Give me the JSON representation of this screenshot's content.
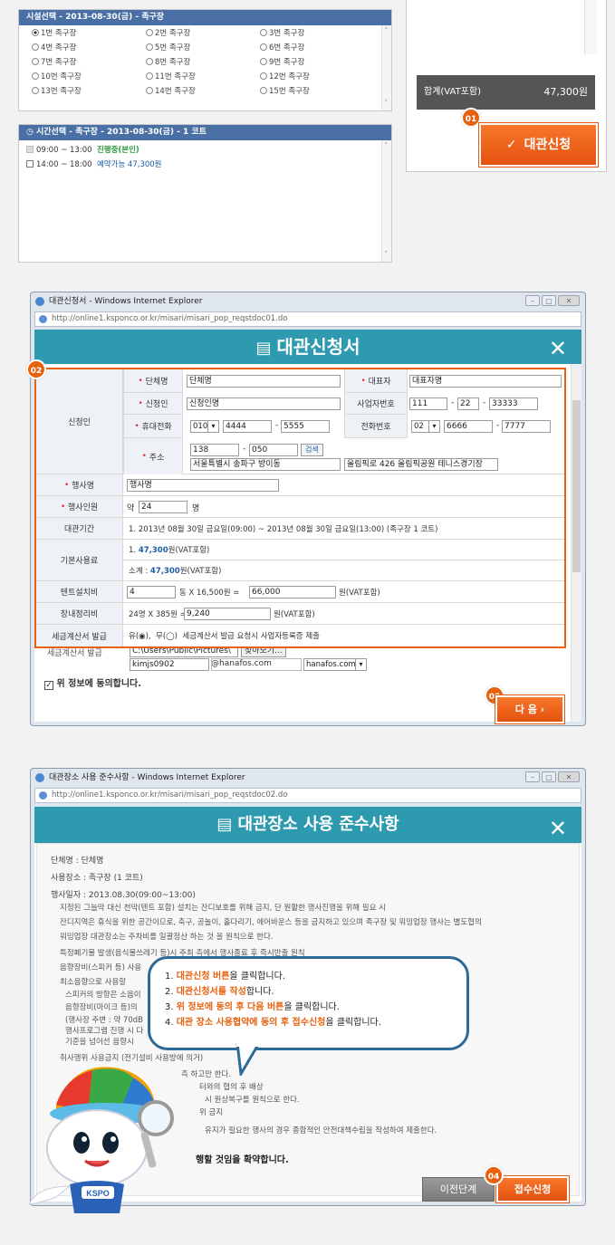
{
  "facility_panel": {
    "title": "시설선택 - 2013-08-30(금) - 족구장",
    "options": [
      "1번 족구장",
      "2번 족구장",
      "3번 족구장",
      "4번 족구장",
      "5번 족구장",
      "6번 족구장",
      "7번 족구장",
      "8번 족구장",
      "9번 족구장",
      "10번 족구장",
      "11번 족구장",
      "12번 족구장",
      "13번 족구장",
      "14번 족구장",
      "15번 족구장"
    ],
    "selected": "1번 족구장"
  },
  "time_panel": {
    "title": "시간선택 - 족구장 - 2013-08-30(금) - 1 코트",
    "slots": [
      {
        "time": "09:00 ~ 13:00",
        "status": "진행중(본인)"
      },
      {
        "time": "14:00 ~ 18:00",
        "status": "예약가능 47,300원"
      }
    ]
  },
  "summary": {
    "total_label": "합계(VAT포함)",
    "total_value": "47,300원",
    "apply_button": "대관신청",
    "check_glyph": "✓"
  },
  "badges": {
    "b1": "01",
    "b2": "02",
    "b3": "03",
    "b4": "04"
  },
  "window1": {
    "title": "대관신청서 - Windows Internet Explorer",
    "url": "http://online1.ksponco.or.kr/misari/misari_pop_reqstdoc01.do",
    "header": "대관신청서",
    "close_glyph": "✕"
  },
  "form": {
    "applicant_label": "신청인",
    "group_label": "단체명",
    "group_value": "단체명",
    "rep_label": "대표자",
    "rep_value": "대표자명",
    "applicant_name_label": "신청인",
    "applicant_name_value": "신청인명",
    "bizno_label": "사업자번호",
    "bizno": [
      "111",
      "22",
      "33333"
    ],
    "mobile_label": "휴대전화",
    "mobile": [
      "010",
      "4444",
      "5555"
    ],
    "phone_label": "전화번호",
    "phone": [
      "02",
      "6666",
      "7777"
    ],
    "address_label": "주소",
    "zip": [
      "138",
      "050"
    ],
    "search_button": "검색",
    "address1": "서울특별시 송파구 방이동",
    "address2": "올림픽로 426 올림픽공원 테니스경기장",
    "event_label": "행사명",
    "event_value": "행사명",
    "people_label": "행사인원",
    "people_prefix": "약",
    "people_value": "24",
    "people_unit": "명",
    "period_label": "대관기간",
    "period_value": "1. 2013년 08월  30일 금요일(09:00) ~ 2013년 08월  30일 금요일(13:00) (족구장 1 코트)",
    "fee_label": "기본사용료",
    "fee_line1_prefix": "1.",
    "fee_line1_value": "47,300",
    "fee_line1_suffix": "원(VAT포함)",
    "fee_line2_prefix": "소계 :",
    "fee_line2_value": "47,300",
    "fee_line2_suffix": "원(VAT포함)",
    "tent_label": "텐트설치비",
    "tent_qty": "4",
    "tent_calc": "동 X 16,500원 =",
    "tent_total": "66,000",
    "tent_suffix": "원(VAT포함)",
    "cleanup_label": "장내정리비",
    "cleanup_calc": "24명 X 385원 =",
    "cleanup_total": "9,240",
    "cleanup_suffix": "원(VAT포함)",
    "invoice_label": "세금계산서 발급",
    "invoice_yes": "유(",
    "invoice_yes_end": "),",
    "invoice_no": "무(",
    "invoice_no_end": ")",
    "invoice_note": "세금계산서 발급 요청시 사업자등록증 제출",
    "radio_on": "◉",
    "radio_off": "◯"
  },
  "form_behind": {
    "label": "세금계산서 발급",
    "file_path": "C:\\Users\\Public\\Pictures\\",
    "file_button": "찾아보기...",
    "email_user": "kimjs0902",
    "email_domain": "@hanafos.com",
    "email_select": "hanafos.com",
    "agree": "위 정보에 동의합니다.",
    "next_button": "다 음 ›"
  },
  "window2": {
    "title": "대관장소 사용 준수사항 - Windows Internet Explorer",
    "url": "http://online1.ksponco.or.kr/misari/misari_pop_reqstdoc02.do",
    "header": "대관장소 사용 준수사항",
    "close_glyph": "✕",
    "lines": [
      "단체명 : 단체명",
      "사용장소 : 족구장 (1 코트)",
      "행사일자 : 2013.08.30(09:00~13:00)",
      "지정된 그늘막 대신 천막(텐트 포함) 설치는 잔디보호를 위해 금지, 단 원활한 행사진행을 위해 필요 시",
      "잔디지역은 휴식을 위한 공간이므로, 축구, 공놀이, 홀다리기, 에어바운스 등을 금지하고 있으며 족구장 및 워밍업장 행사는 별도협의",
      "워밍업장 대관장소는 주차비를 일괄정산 하는 것 을 원칙으로 한다.",
      "특정폐기물 발생(음식물쓰레기 등)시 주최 측에서 행사종료 후 즉시반출 원칙",
      "음향장비(스피커 등) 사용",
      "최소음향으로 사용할",
      "스피커의 방향은 소음이",
      "음향장비(마이크 등)의",
      "(행사장 주변 : 약 70dB",
      "행사프로그램 진행 시 다",
      "기준을 넘어선 음향시",
      "취사행위",
      "사용금지 (전기설비 사용방에 의거)",
      "측 하고만 한다.",
      "터와의 협의 후 배상",
      "시 원상복구를 원칙으로 한다.",
      "위 금지",
      "유지가 필요한 행사의 경우 종합적인 안전대책수립을 작성하여 제출한다.",
      "행할 것임을 확약합니다.",
      "을 금지를 원칙으로 하되"
    ],
    "prev_button": "이전단계",
    "submit_button": "접수신청"
  },
  "bubble": {
    "steps": [
      {
        "n": "1.",
        "hl": "대관신청 버튼",
        "rest": "을 클릭합니다."
      },
      {
        "n": "2.",
        "hl": "대관신청서를 작성",
        "rest": "합니다."
      },
      {
        "n": "3.",
        "hl": "위 정보에 동의 후 다음 버튼",
        "rest": "을 클릭합니다."
      },
      {
        "n": "4.",
        "hl": "대관 장소 사용협약에 동의 후 접수신청",
        "rest": "을 클릭합니다."
      }
    ]
  },
  "mascot": {
    "logo_text": "KSPO"
  },
  "colors": {
    "accent": "#e8610e",
    "header_teal": "#2e9ab0",
    "panel_blue": "#4a6fa5"
  }
}
